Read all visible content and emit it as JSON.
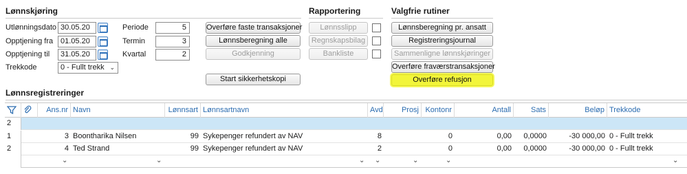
{
  "lonnskjoring": {
    "title": "Lønnskjøring",
    "utlonningsdato_label": "Utlønningsdato",
    "utlonningsdato_value": "30.05.20",
    "opptjening_fra_label": "Opptjening fra",
    "opptjening_fra_value": "01.05.20",
    "opptjening_til_label": "Opptjening til",
    "opptjening_til_value": "31.05.20",
    "trekkode_label": "Trekkode",
    "trekkode_value": "0 - Fullt trekk",
    "periode_label": "Periode",
    "periode_value": "5",
    "termin_label": "Termin",
    "termin_value": "3",
    "kvartal_label": "Kvartal",
    "kvartal_value": "2"
  },
  "actions": {
    "overfore_faste": "Overføre faste transaksjoner",
    "lonnsberegning_alle": "Lønnsberegning alle",
    "godkjenning": "Godkjenning",
    "start_sikkerhetskopi": "Start sikkerhetskopi"
  },
  "rapportering": {
    "title": "Rapportering",
    "lonnsslipp": "Lønnsslipp",
    "regnskapsbilag": "Regnskapsbilag",
    "bankliste": "Bankliste"
  },
  "valgfrie": {
    "title": "Valgfrie rutiner",
    "lonnsberegning_pr_ansatt": "Lønnsberegning pr. ansatt",
    "registreringsjournal": "Registreringsjournal",
    "sammenligne": "Sammenligne lønnskjøringer",
    "overfore_fravaer": "Overføre fraværstransaksjoner",
    "overfore_refusjon": "Overføre refusjon"
  },
  "registreringer": {
    "title": "Lønnsregistreringer",
    "columns": {
      "ans_nr": "Ans.nr",
      "navn": "Navn",
      "lonnsart": "Lønnsart",
      "lonnsartnavn": "Lønnsartnavn",
      "avd": "Avd",
      "prosj": "Prosj",
      "kontonr": "Kontonr",
      "antall": "Antall",
      "sats": "Sats",
      "belop": "Beløp",
      "trekkode": "Trekkode"
    },
    "filter_row_num": "2",
    "rows": [
      {
        "num": "1",
        "ans_nr": "3",
        "navn": "Boontharika Nilsen",
        "lonnsart": "99",
        "lonnsartnavn": "Sykepenger refundert av NAV",
        "avd": "8",
        "prosj": "",
        "kontonr": "0",
        "antall": "0,00",
        "sats": "0,0000",
        "belop": "-30 000,00",
        "trekkode": "0 - Fullt trekk"
      },
      {
        "num": "2",
        "ans_nr": "4",
        "navn": "Ted Strand",
        "lonnsart": "99",
        "lonnsartnavn": "Sykepenger refundert av NAV",
        "avd": "2",
        "prosj": "",
        "kontonr": "0",
        "antall": "0,00",
        "sats": "0,0000",
        "belop": "-30 000,00",
        "trekkode": "0 - Fullt trekk"
      }
    ]
  }
}
